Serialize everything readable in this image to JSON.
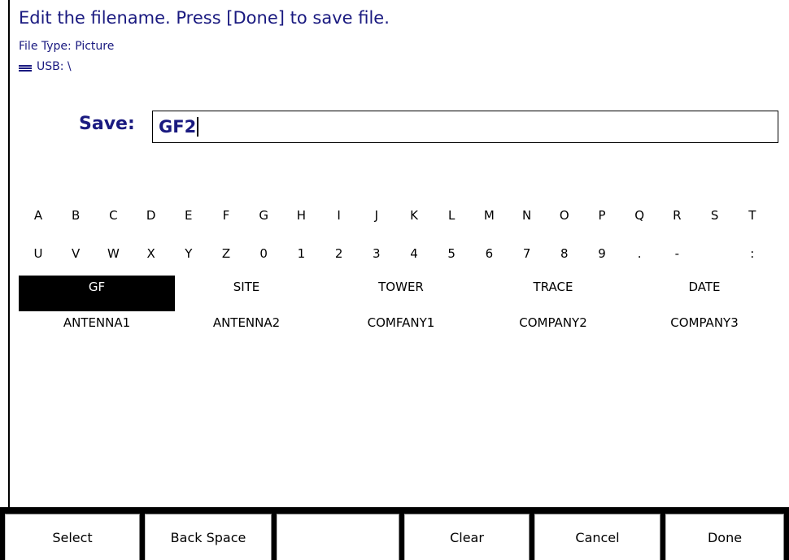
{
  "header": {
    "instruction": "Edit the filename.  Press [Done] to save file.",
    "file_type": "File Type: Picture",
    "location": "USB: \\"
  },
  "save": {
    "label": "Save:",
    "value": "GF2"
  },
  "keyboard": {
    "row1": [
      "A",
      "B",
      "C",
      "D",
      "E",
      "F",
      "G",
      "H",
      "I",
      "J",
      "K",
      "L",
      "M",
      "N",
      "O",
      "P",
      "Q",
      "R",
      "S",
      "T"
    ],
    "row2": [
      "U",
      "V",
      "W",
      "X",
      "Y",
      "Z",
      "0",
      "1",
      "2",
      "3",
      "4",
      "5",
      "6",
      "7",
      "8",
      "9",
      ".",
      "-",
      "",
      ":"
    ]
  },
  "presets": {
    "row1": [
      "GF",
      "SITE",
      "TOWER",
      "TRACE",
      "DATE"
    ],
    "row2": [
      "ANTENNA1",
      "ANTENNA2",
      "COMFANY1",
      "COMPANY2",
      "COMPANY3"
    ],
    "selected": "GF"
  },
  "softkeys": [
    "Select",
    "Back Space",
    "",
    "Clear",
    "Cancel",
    "Done"
  ]
}
